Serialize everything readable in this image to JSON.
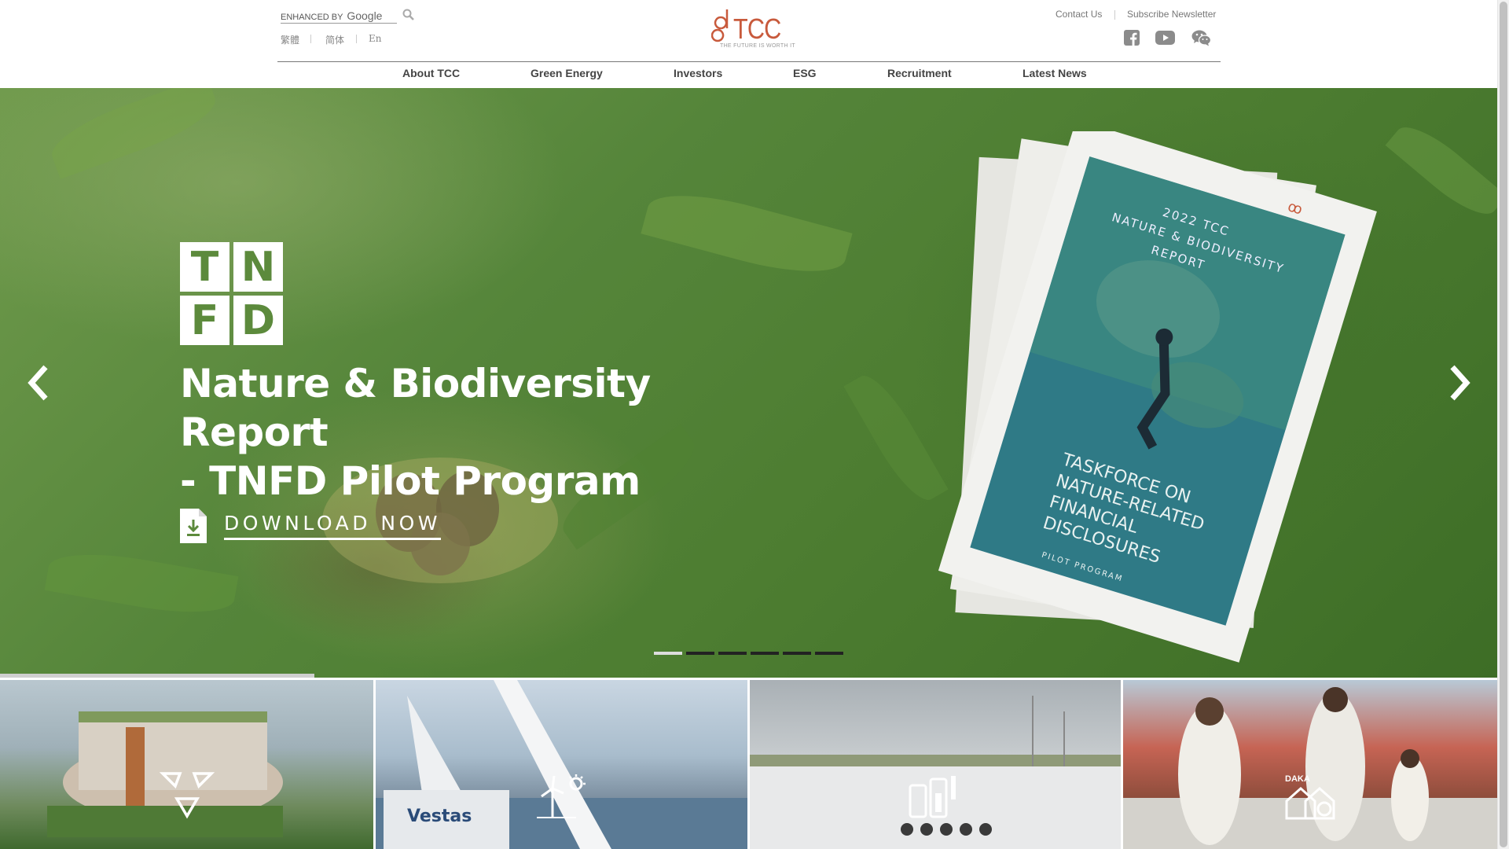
{
  "header": {
    "search": {
      "placeholder": "",
      "brand_prefix": "ENHANCED BY",
      "brand_name": "Google"
    },
    "languages": [
      "繁體",
      "简体",
      "En"
    ],
    "logo": {
      "text": "TCC",
      "tagline": "THE FUTURE IS WORTH IT",
      "color": "#c85a3c"
    },
    "links": {
      "contact": "Contact Us",
      "newsletter": "Subscribe Newsletter"
    },
    "social_icons": [
      "facebook-icon",
      "youtube-icon",
      "wechat-icon"
    ]
  },
  "nav": {
    "items": [
      "About TCC",
      "Green Energy",
      "Investors",
      "ESG",
      "Recruitment",
      "Latest News"
    ]
  },
  "hero": {
    "badge_letters": [
      "T",
      "N",
      "F",
      "D"
    ],
    "title_line1": "Nature & Biodiversity Report",
    "title_line2": "- TNFD Pilot Program",
    "download_label": "DOWNLOAD NOW",
    "slides_total": 6,
    "active_slide": 1,
    "report_cover": {
      "line1": "2022 TCC",
      "line2": "NATURE & BIODIVERSITY",
      "line3": "REPORT",
      "line4": "TASKFORCE ON",
      "line5": "NATURE-RELATED",
      "line6": "FINANCIAL",
      "line7": "DISCLOSURES",
      "line8": "PILOT PROGRAM"
    }
  },
  "tiles": [
    {
      "name": "recycle",
      "icon": "recycle-icon"
    },
    {
      "name": "wind-solar",
      "icon": "wind-solar-icon"
    },
    {
      "name": "energy-storage",
      "icon": "battery-storage-icon"
    },
    {
      "name": "daka",
      "icon": "daka-home-icon",
      "icon_label": "DAKA"
    }
  ],
  "colors": {
    "hero_green": "#5c8a3c",
    "nav_text": "#444444"
  }
}
